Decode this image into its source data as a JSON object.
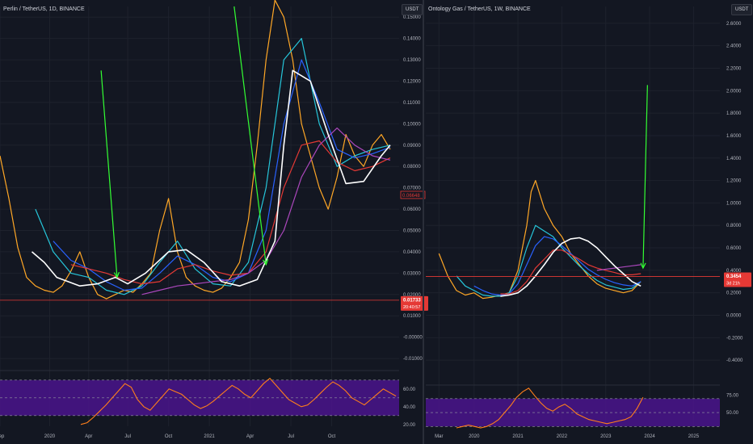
{
  "colors": {
    "background": "#131722",
    "grid": "#1e222d",
    "axis_text": "#b2b5be",
    "rsi_band": "#4a148c",
    "rsi_line": "#ff7f1a",
    "arrow": "#33ff33",
    "ma_white": "#ffffff",
    "ma_teal": "#26c6da",
    "ma_blue": "#2962ff",
    "ma_red": "#e53935",
    "ma_purple": "#ab47bc",
    "ma_orange": "#ffa726",
    "ma_green": "#66bb6a",
    "price_line": "#e53935"
  },
  "chart_data": [
    {
      "type": "line",
      "title": "Perlin / TetherUS, 1D, BINANCE",
      "currency_badge": "USDT",
      "x_ticks": [
        "Sep",
        "2020",
        "Apr",
        "Jul",
        "Oct",
        "2021",
        "Apr",
        "Jul",
        "Oct"
      ],
      "y_ticks": [
        "0.15000",
        "0.14000",
        "0.13000",
        "0.12000",
        "0.11000",
        "0.10000",
        "0.09000",
        "0.08000",
        "0.07000",
        "0.06000",
        "0.05000",
        "0.04000",
        "0.03000",
        "0.02000",
        "0.01000",
        "-0.00000",
        "-0.01000"
      ],
      "ylim": [
        -0.013,
        0.155
      ],
      "price_label": "0.01733",
      "price_countdown": "20:40:57",
      "ma_label": "0.06648",
      "arrows": [
        {
          "from_t": 0.57,
          "from_v": 0.125,
          "to_t": 0.66,
          "to_v": 0.028
        },
        {
          "from_t": 1.32,
          "from_v": 0.155,
          "to_t": 1.5,
          "to_v": 0.034
        }
      ],
      "series": [
        {
          "color_key": "ma_orange",
          "x": [
            0.0,
            0.05,
            0.1,
            0.15,
            0.2,
            0.25,
            0.3,
            0.35,
            0.4,
            0.45,
            0.5,
            0.55,
            0.6,
            0.65,
            0.7,
            0.75,
            0.8,
            0.85,
            0.9,
            0.95,
            1.0,
            1.05,
            1.1,
            1.15,
            1.2,
            1.25,
            1.3,
            1.35,
            1.4,
            1.45,
            1.5,
            1.55,
            1.6,
            1.65,
            1.7,
            1.75,
            1.8,
            1.85,
            1.9,
            1.95,
            2.0,
            2.05,
            2.1,
            2.15,
            2.2
          ],
          "y": [
            0.085,
            0.065,
            0.042,
            0.028,
            0.024,
            0.022,
            0.021,
            0.024,
            0.031,
            0.04,
            0.028,
            0.02,
            0.018,
            0.02,
            0.022,
            0.021,
            0.025,
            0.03,
            0.05,
            0.065,
            0.04,
            0.028,
            0.024,
            0.022,
            0.021,
            0.023,
            0.028,
            0.035,
            0.055,
            0.09,
            0.13,
            0.158,
            0.15,
            0.13,
            0.1,
            0.085,
            0.07,
            0.06,
            0.075,
            0.095,
            0.085,
            0.08,
            0.09,
            0.095,
            0.088
          ]
        },
        {
          "color_key": "ma_teal",
          "x": [
            0.2,
            0.3,
            0.4,
            0.5,
            0.6,
            0.7,
            0.8,
            0.9,
            1.0,
            1.1,
            1.2,
            1.3,
            1.4,
            1.5,
            1.6,
            1.7,
            1.8,
            1.9,
            2.0,
            2.1,
            2.2
          ],
          "y": [
            0.06,
            0.04,
            0.03,
            0.028,
            0.022,
            0.02,
            0.024,
            0.035,
            0.045,
            0.032,
            0.025,
            0.024,
            0.035,
            0.07,
            0.13,
            0.14,
            0.1,
            0.08,
            0.085,
            0.088,
            0.09
          ]
        },
        {
          "color_key": "ma_blue",
          "x": [
            0.3,
            0.4,
            0.5,
            0.6,
            0.7,
            0.8,
            0.9,
            1.0,
            1.1,
            1.2,
            1.3,
            1.4,
            1.5,
            1.6,
            1.7,
            1.8,
            1.9,
            2.0,
            2.1,
            2.2
          ],
          "y": [
            0.045,
            0.036,
            0.032,
            0.026,
            0.022,
            0.023,
            0.03,
            0.038,
            0.034,
            0.028,
            0.026,
            0.03,
            0.05,
            0.1,
            0.13,
            0.11,
            0.088,
            0.084,
            0.086,
            0.089
          ]
        },
        {
          "color_key": "ma_red",
          "x": [
            0.4,
            0.5,
            0.6,
            0.7,
            0.8,
            0.9,
            1.0,
            1.1,
            1.2,
            1.3,
            1.4,
            1.5,
            1.6,
            1.7,
            1.8,
            1.9,
            2.0,
            2.1,
            2.2
          ],
          "y": [
            0.034,
            0.032,
            0.03,
            0.027,
            0.025,
            0.026,
            0.032,
            0.034,
            0.031,
            0.029,
            0.03,
            0.04,
            0.07,
            0.09,
            0.092,
            0.082,
            0.078,
            0.08,
            0.084
          ]
        },
        {
          "color_key": "ma_purple",
          "x": [
            0.8,
            0.9,
            1.0,
            1.1,
            1.2,
            1.3,
            1.4,
            1.5,
            1.6,
            1.7,
            1.8,
            1.9,
            2.0,
            2.1,
            2.2
          ],
          "y": [
            0.02,
            0.022,
            0.024,
            0.025,
            0.026,
            0.027,
            0.03,
            0.036,
            0.05,
            0.075,
            0.09,
            0.098,
            0.09,
            0.085,
            0.083
          ]
        },
        {
          "color_key": "ma_white",
          "x": [
            0.18,
            0.25,
            0.32,
            0.45,
            0.55,
            0.65,
            0.72,
            0.82,
            0.95,
            1.05,
            1.15,
            1.25,
            1.35,
            1.45,
            1.55,
            1.6,
            1.65,
            1.75,
            1.85,
            1.95,
            2.05,
            2.15,
            2.2
          ],
          "y": [
            0.04,
            0.035,
            0.028,
            0.024,
            0.025,
            0.028,
            0.025,
            0.03,
            0.04,
            0.041,
            0.035,
            0.026,
            0.024,
            0.027,
            0.045,
            0.09,
            0.125,
            0.12,
            0.095,
            0.072,
            0.073,
            0.085,
            0.09
          ]
        }
      ],
      "rsi": {
        "y_ticks": [
          "60.00",
          "40.00",
          "20.00"
        ],
        "ylim": [
          18,
          78
        ],
        "band": [
          30,
          70
        ],
        "values": [
          20,
          22,
          28,
          35,
          42,
          50,
          58,
          66,
          62,
          48,
          40,
          36,
          44,
          52,
          60,
          57,
          54,
          48,
          42,
          38,
          41,
          46,
          52,
          58,
          64,
          60,
          54,
          50,
          58,
          66,
          72,
          64,
          56,
          48,
          44,
          40,
          42,
          48,
          55,
          62,
          68,
          64,
          58,
          50,
          46,
          42,
          48,
          54,
          60,
          56,
          52
        ]
      }
    },
    {
      "type": "line",
      "title": "Ontology Gas / TetherUS, 1W, BINANCE",
      "currency_badge": "USDT",
      "x_ticks": [
        "Mar",
        "2020",
        "2021",
        "2022",
        "2023",
        "2024",
        "2025"
      ],
      "y_ticks": [
        "2.6000",
        "2.4000",
        "2.2000",
        "2.0000",
        "1.8000",
        "1.6000",
        "1.4000",
        "1.2000",
        "1.0000",
        "0.8000",
        "0.6000",
        "0.4000",
        "0.2000",
        "0.0000",
        "-0.2000",
        "-0.4000"
      ],
      "ylim": [
        -0.55,
        2.75
      ],
      "price_label": "0.3454",
      "price_countdown": "3d 21h",
      "arrows": [
        {
          "from_t": 2023.95,
          "from_v": 2.05,
          "to_t": 2023.85,
          "to_v": 0.42
        }
      ],
      "series": [
        {
          "color_key": "ma_orange",
          "x": [
            2019.2,
            2019.4,
            2019.6,
            2019.8,
            2020.0,
            2020.2,
            2020.4,
            2020.6,
            2020.8,
            2021.0,
            2021.2,
            2021.3,
            2021.4,
            2021.6,
            2021.8,
            2022.0,
            2022.2,
            2022.4,
            2022.6,
            2022.8,
            2023.0,
            2023.2,
            2023.4,
            2023.6,
            2023.8
          ],
          "y": [
            0.55,
            0.35,
            0.22,
            0.18,
            0.2,
            0.15,
            0.16,
            0.18,
            0.2,
            0.4,
            0.8,
            1.1,
            1.2,
            0.95,
            0.8,
            0.7,
            0.55,
            0.45,
            0.35,
            0.28,
            0.24,
            0.22,
            0.2,
            0.22,
            0.3
          ]
        },
        {
          "color_key": "ma_teal",
          "x": [
            2019.6,
            2019.8,
            2020.0,
            2020.2,
            2020.4,
            2020.6,
            2020.8,
            2021.0,
            2021.2,
            2021.4,
            2021.6,
            2021.8,
            2022.0,
            2022.2,
            2022.4,
            2022.6,
            2022.8,
            2023.0,
            2023.2,
            2023.4,
            2023.6,
            2023.8
          ],
          "y": [
            0.35,
            0.26,
            0.22,
            0.18,
            0.17,
            0.17,
            0.2,
            0.35,
            0.6,
            0.8,
            0.75,
            0.7,
            0.6,
            0.52,
            0.44,
            0.37,
            0.31,
            0.27,
            0.25,
            0.23,
            0.24,
            0.3
          ]
        },
        {
          "color_key": "ma_blue",
          "x": [
            2020.0,
            2020.2,
            2020.4,
            2020.6,
            2020.8,
            2021.0,
            2021.2,
            2021.4,
            2021.6,
            2021.8,
            2022.0,
            2022.2,
            2022.4,
            2022.6,
            2022.8,
            2023.0,
            2023.2,
            2023.4,
            2023.6,
            2023.8
          ],
          "y": [
            0.26,
            0.22,
            0.19,
            0.18,
            0.19,
            0.28,
            0.45,
            0.62,
            0.7,
            0.68,
            0.62,
            0.55,
            0.48,
            0.41,
            0.36,
            0.32,
            0.29,
            0.27,
            0.26,
            0.3
          ]
        },
        {
          "color_key": "ma_red",
          "x": [
            2020.6,
            2020.8,
            2021.0,
            2021.2,
            2021.4,
            2021.6,
            2021.8,
            2022.0,
            2022.2,
            2022.4,
            2022.6,
            2022.8,
            2023.0,
            2023.2,
            2023.4,
            2023.6,
            2023.8
          ],
          "y": [
            0.19,
            0.19,
            0.22,
            0.3,
            0.42,
            0.5,
            0.58,
            0.58,
            0.54,
            0.5,
            0.45,
            0.42,
            0.4,
            0.38,
            0.36,
            0.36,
            0.37
          ]
        },
        {
          "color_key": "ma_purple",
          "x": [
            2022.8,
            2023.0,
            2023.2,
            2023.4,
            2023.6,
            2023.8
          ],
          "y": [
            0.4,
            0.41,
            0.42,
            0.43,
            0.44,
            0.45
          ]
        },
        {
          "color_key": "ma_white",
          "x": [
            2020.6,
            2020.8,
            2021.0,
            2021.2,
            2021.4,
            2021.6,
            2021.8,
            2022.0,
            2022.2,
            2022.4,
            2022.6,
            2022.8,
            2023.0,
            2023.2,
            2023.4,
            2023.6,
            2023.8
          ],
          "y": [
            0.17,
            0.18,
            0.2,
            0.26,
            0.35,
            0.45,
            0.56,
            0.64,
            0.68,
            0.69,
            0.66,
            0.6,
            0.52,
            0.44,
            0.37,
            0.3,
            0.26
          ]
        }
      ],
      "rsi": {
        "y_ticks": [
          "75.00",
          "50.00"
        ],
        "ylim": [
          28,
          86
        ],
        "band": [
          30,
          70
        ],
        "values": [
          28,
          30,
          32,
          30,
          28,
          30,
          34,
          40,
          50,
          60,
          72,
          80,
          85,
          74,
          64,
          56,
          52,
          58,
          62,
          56,
          48,
          44,
          40,
          38,
          36,
          34,
          36,
          38,
          40,
          44,
          56,
          72
        ]
      }
    }
  ]
}
